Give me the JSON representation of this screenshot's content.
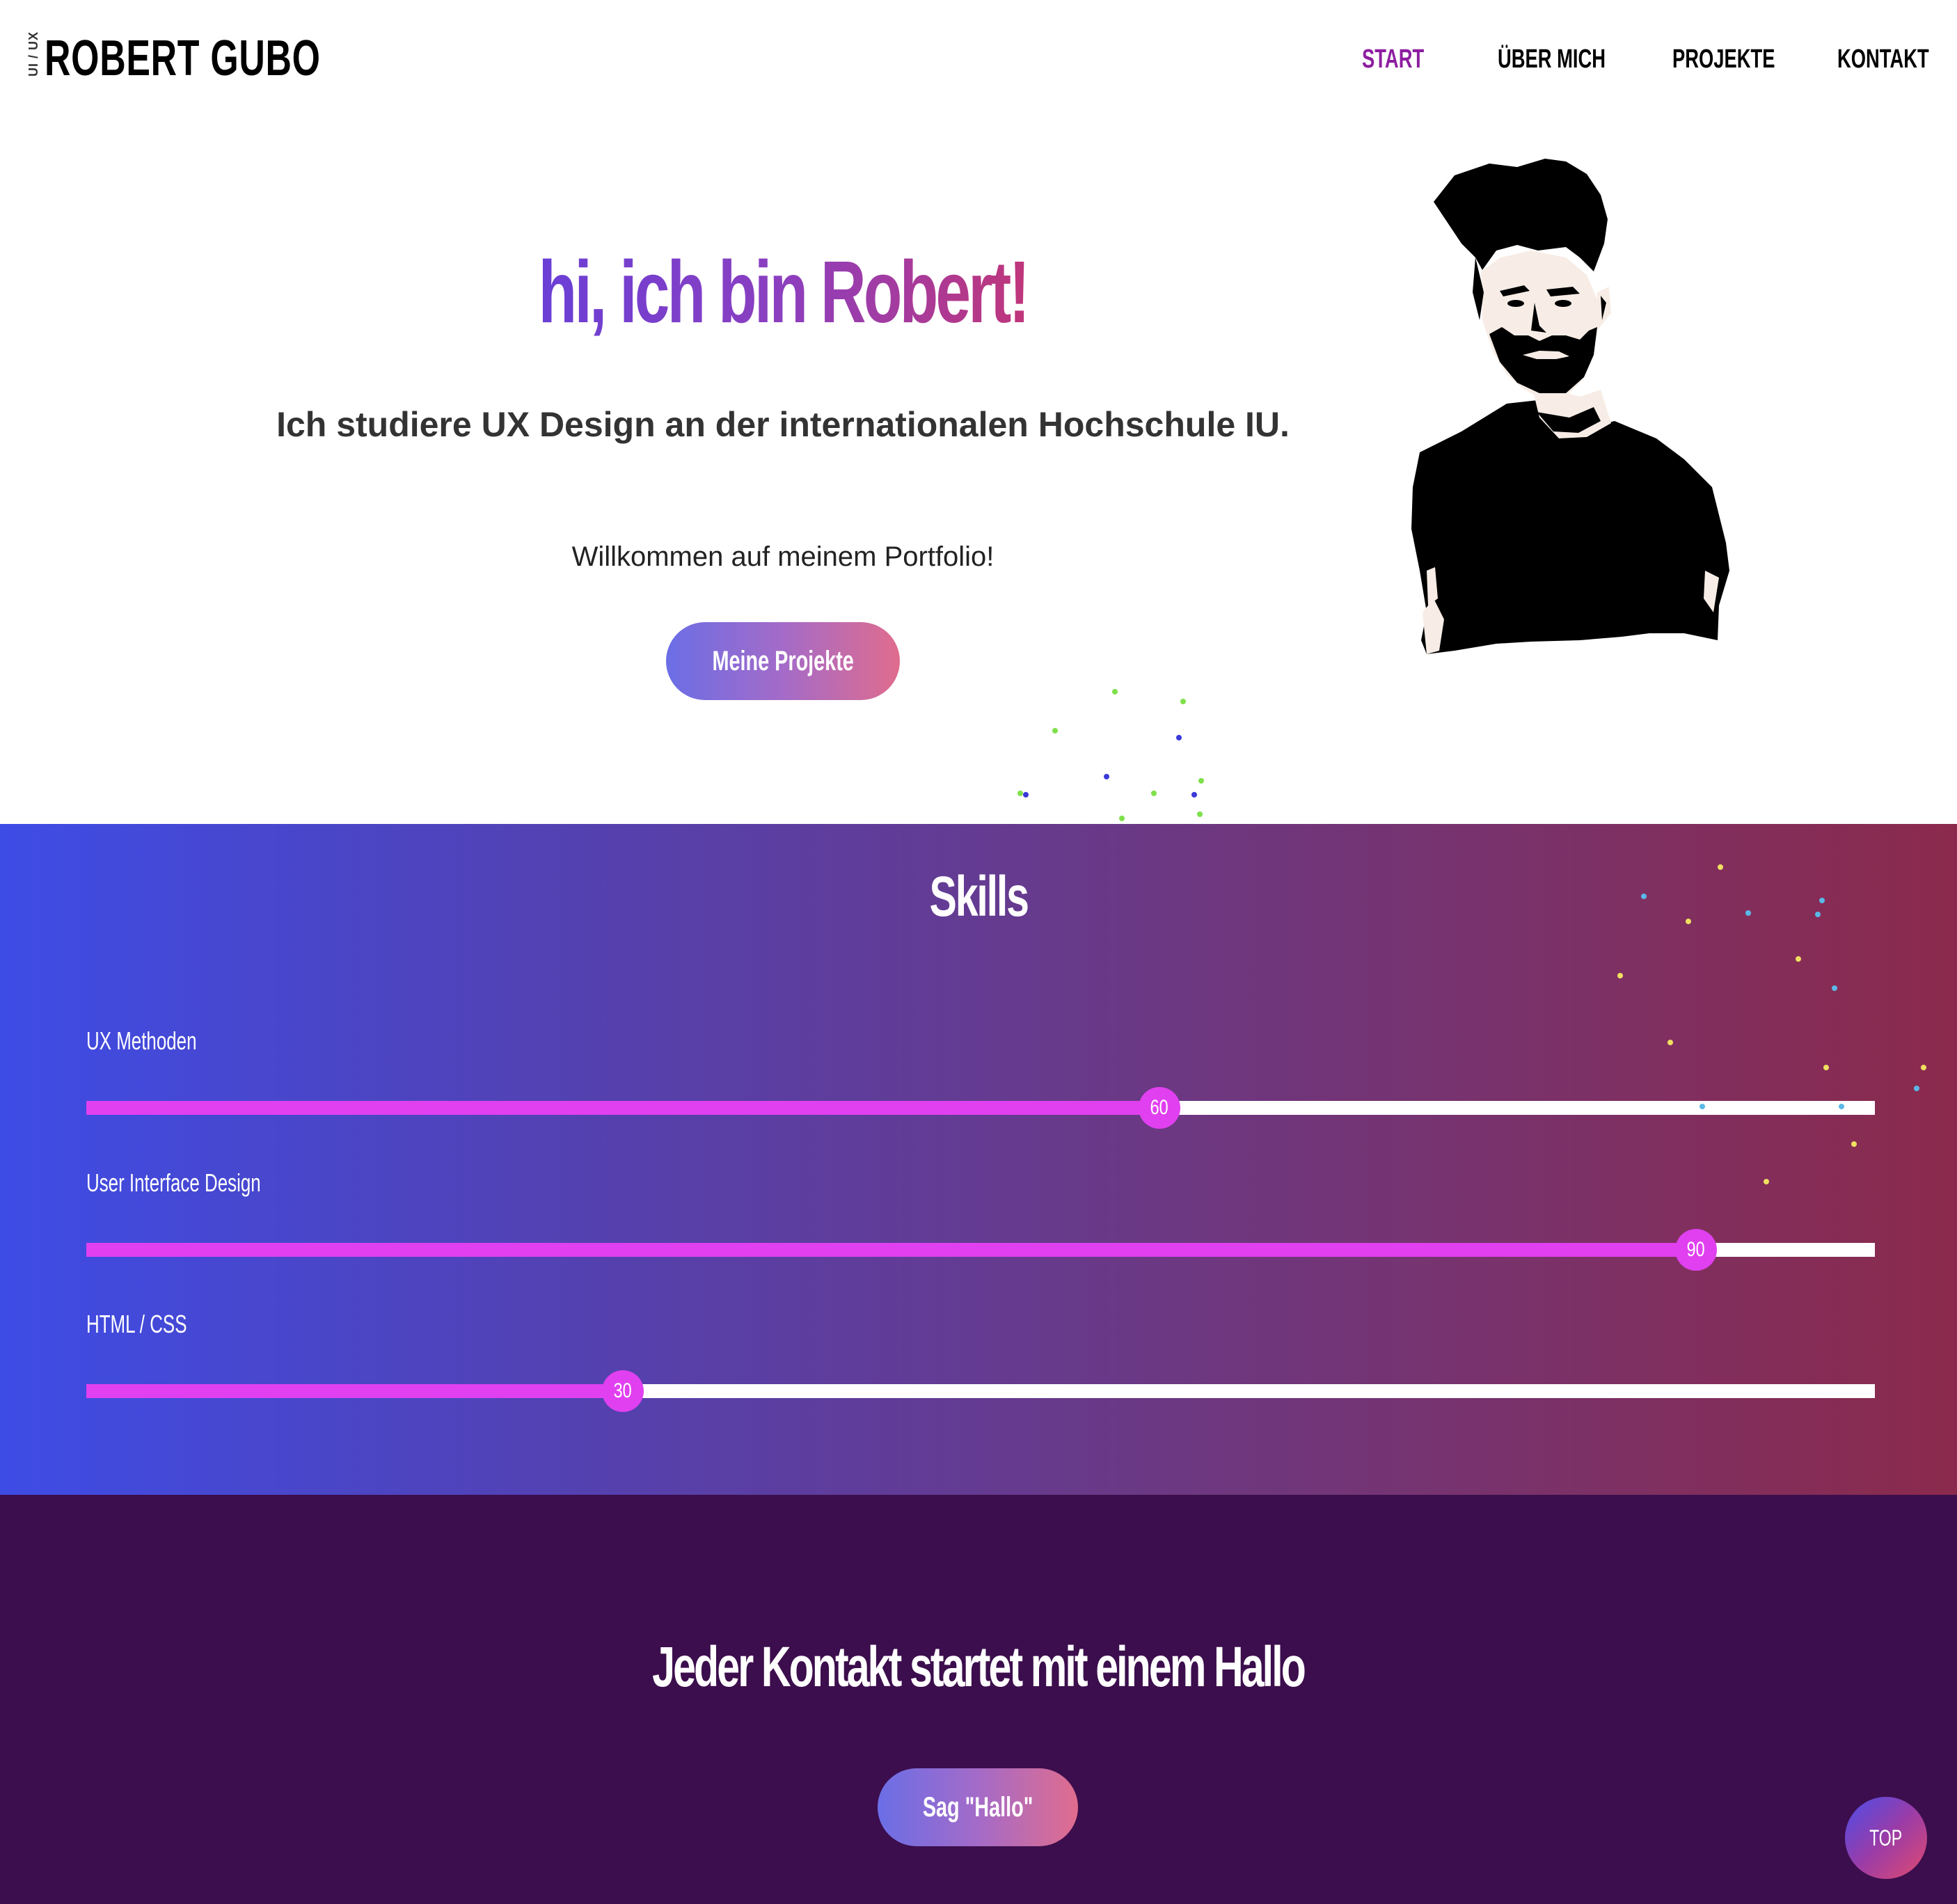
{
  "header": {
    "logo_tag": "UI / UX",
    "logo_name": "ROBERT GUBO",
    "nav": [
      {
        "label": "START",
        "active": true
      },
      {
        "label": "ÜBER MICH",
        "active": false
      },
      {
        "label": "PROJEKTE",
        "active": false
      },
      {
        "label": "KONTAKT",
        "active": false
      }
    ],
    "active_color": "#8d1ea0"
  },
  "hero": {
    "title": "hi, ich bin Robert!",
    "subtitle": "Ich studiere UX Design an der internationalen Hochschule IU.",
    "welcome": "Willkommen auf meinem Portfolio!",
    "cta_label": "Meine Projekte",
    "portrait_icon": "portrait-illustration"
  },
  "skills": {
    "title": "Skills",
    "items": [
      {
        "label": "UX Methoden",
        "value": 60,
        "value_text": "60"
      },
      {
        "label": "User Interface Design",
        "value": 90,
        "value_text": "90"
      },
      {
        "label": "HTML / CSS",
        "value": 30,
        "value_text": "30"
      }
    ],
    "max": 100,
    "fill_color": "#e040f0"
  },
  "contact": {
    "title": "Jeder Kontakt startet mit einem Hallo",
    "cta_label": "Sag \"Hallo\""
  },
  "top_button": {
    "label": "TOP"
  }
}
